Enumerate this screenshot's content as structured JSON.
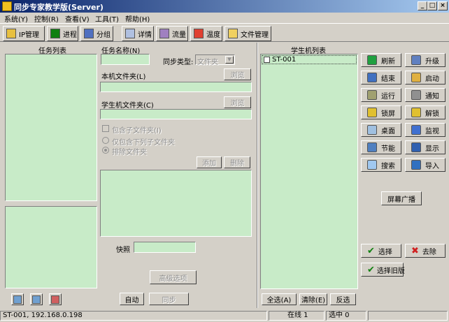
{
  "window": {
    "title": "同步专家教学版(Server)"
  },
  "menu": [
    "系统(Y)",
    "控制(R)",
    "查看(V)",
    "工具(T)",
    "帮助(H)"
  ],
  "toolbar": {
    "ip": "IP管理",
    "process": "进程",
    "group": "分组",
    "detail": "详情",
    "traffic": "流量",
    "temp": "温度",
    "files": "文件管理"
  },
  "tasks": {
    "title": "任务列表"
  },
  "form": {
    "task_name_label": "任务名称(N)",
    "task_name_value": "",
    "sync_type_label": "同步类型:",
    "sync_type_value": "文件夹",
    "local_label": "本机文件夹(L)",
    "local_browse": "浏览",
    "student_label": "学生机文件夹(C)",
    "student_browse": "浏览",
    "include_sub": "包含子文件夹(I)",
    "only_include": "仅包含下列子文件夹",
    "exclude": "排除文件夹",
    "add": "添加",
    "delete": "删除",
    "snapshot_label": "快照",
    "advanced": "高级选项",
    "auto": "自动",
    "sync": "同步"
  },
  "students": {
    "title": "学生机列表",
    "items": [
      {
        "name": "ST-001",
        "checked": false
      }
    ],
    "select_all": "全选(A)",
    "clear": "清除(E)",
    "invert": "反选"
  },
  "commands": {
    "left": [
      "刷新",
      "结束",
      "运行",
      "锁屏",
      "桌面",
      "节能",
      "搜索"
    ],
    "right": [
      "升级",
      "启动",
      "通知",
      "解锁",
      "监视",
      "显示",
      "导入"
    ],
    "broadcast": "屏幕广播",
    "select": "选择",
    "remove": "去除",
    "select_old": "选择旧版"
  },
  "status": {
    "host": "ST-001, 192.168.0.198",
    "online": "在线 1",
    "selected": "选中 0"
  }
}
